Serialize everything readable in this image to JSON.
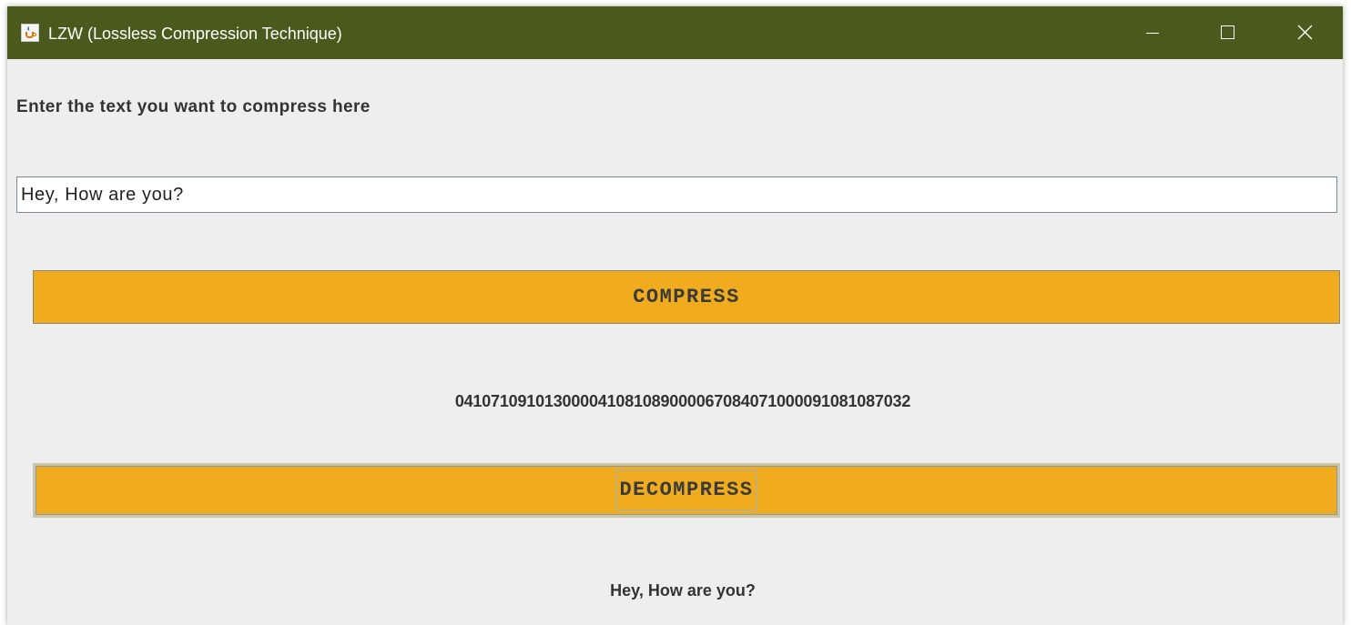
{
  "window": {
    "title": "LZW (Lossless Compression Technique)",
    "titlebar_color": "#4a5a1c",
    "icon": "java-cup-icon",
    "controls": {
      "minimize_icon": "minimize-icon",
      "maximize_icon": "maximize-icon",
      "close_icon": "close-icon"
    }
  },
  "form": {
    "prompt_label": "Enter the text you want to compress here",
    "input_value": "Hey, How are you?",
    "compress_label": "COMPRESS",
    "compressed_output": "04107109101300004108108900006708407100009108108703​2",
    "decompress_label": "DECOMPRESS",
    "decompressed_output": "Hey, How are you?"
  },
  "colors": {
    "button_background": "#f0ac1e",
    "panel_background": "#eeeeee"
  }
}
